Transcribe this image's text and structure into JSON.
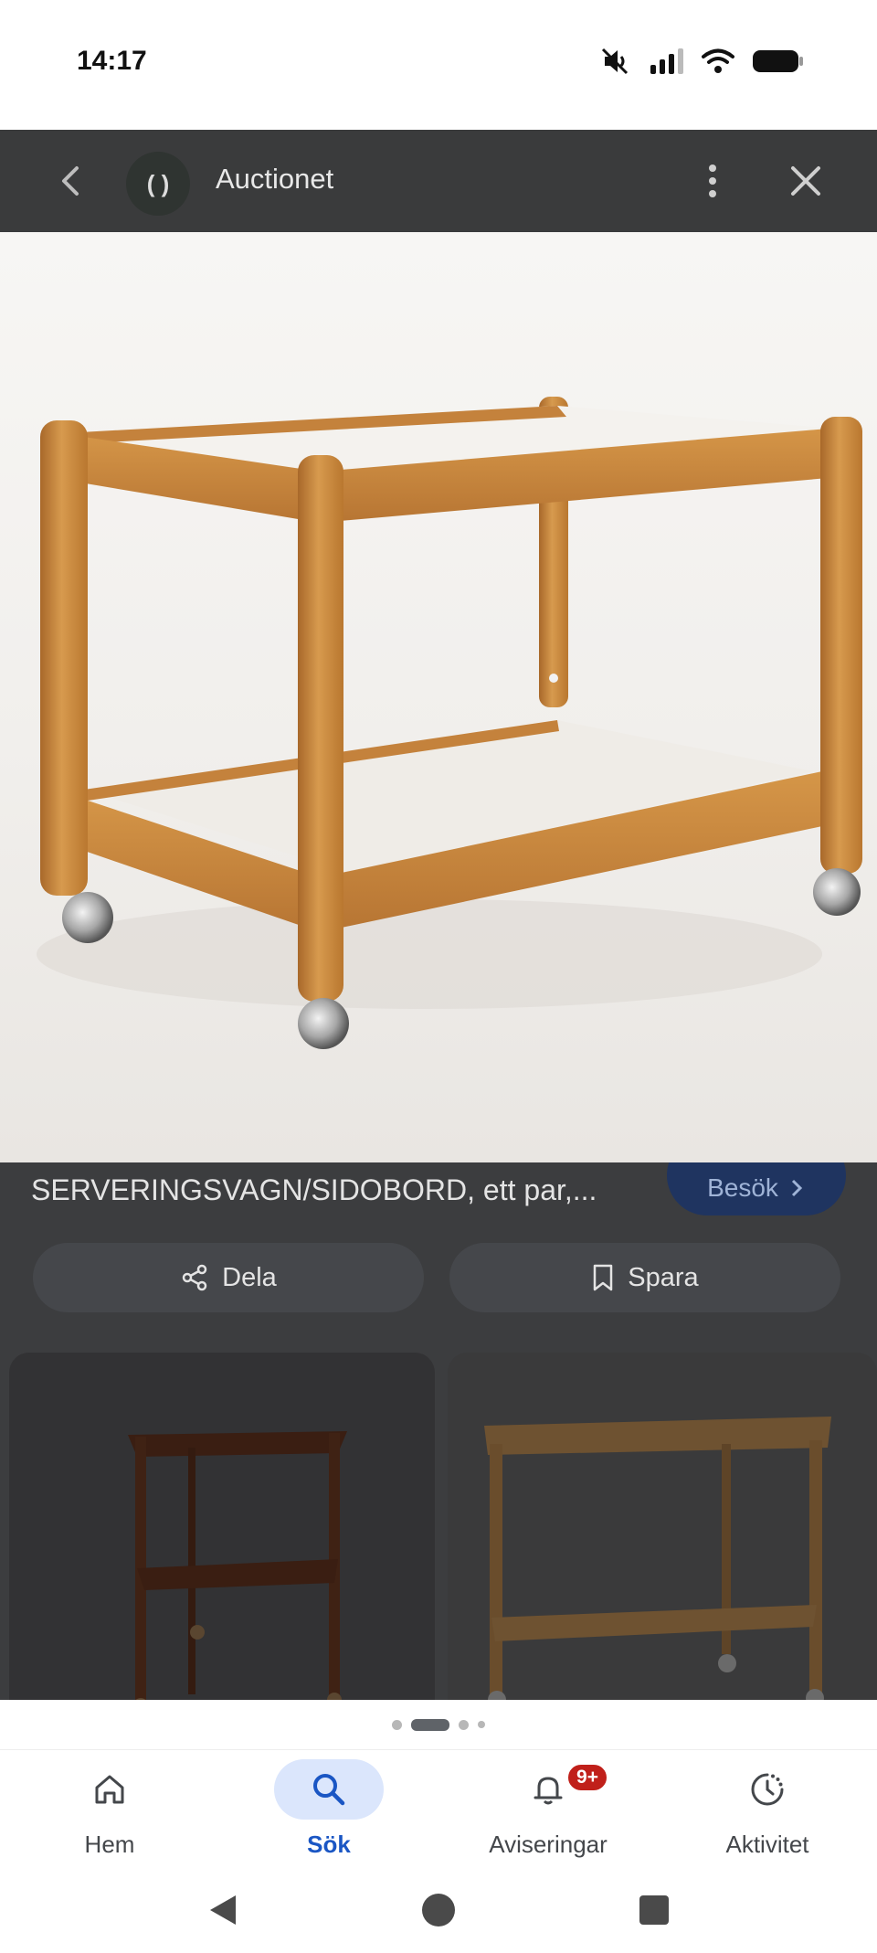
{
  "status_bar": {
    "time": "14:17",
    "icons": [
      "mute-icon",
      "signal-icon",
      "wifi-icon",
      "battery-icon"
    ]
  },
  "toolbar": {
    "title": "Auctionet",
    "logo_text": "( )",
    "icons": [
      "back-arrow-icon",
      "more-vertical-icon",
      "close-icon"
    ]
  },
  "item": {
    "title": "SERVERINGSVAGN/SIDOBORD, ett par,...",
    "visit_label": "Besök",
    "share_label": "Dela",
    "save_label": "Spara"
  },
  "carousel": {
    "count": 4,
    "active_index": 1
  },
  "bottom_nav": {
    "items": [
      {
        "label": "Hem",
        "icon": "home-icon"
      },
      {
        "label": "Sök",
        "icon": "search-icon"
      },
      {
        "label": "Aviseringar",
        "icon": "bell-icon",
        "badge": "9+"
      },
      {
        "label": "Aktivitet",
        "icon": "activity-clock-icon"
      }
    ],
    "active": "Sök"
  },
  "colors": {
    "toolbar_bg": "#3a3b3c",
    "accent": "#1a56c4",
    "badge": "#c0201a",
    "wood": "#c98a3e"
  }
}
